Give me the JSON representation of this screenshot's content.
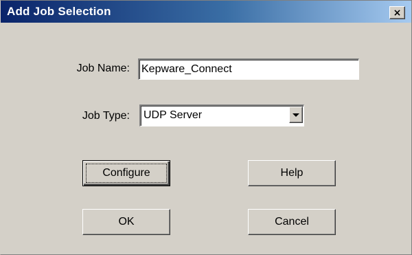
{
  "dialog": {
    "title": "Add Job Selection",
    "close_glyph": "×",
    "close_icon": "close-icon"
  },
  "form": {
    "job_name_label": "Job Name:",
    "job_name_value": "Kepware_Connect",
    "job_type_label": "Job Type:",
    "job_type_selected": "UDP Server",
    "dropdown_icon": "chevron-down-icon"
  },
  "buttons": {
    "configure": "Configure",
    "help": "Help",
    "ok": "OK",
    "cancel": "Cancel"
  },
  "colors": {
    "title_bar_start": "#0a246a",
    "title_bar_end": "#a6caf0",
    "dialog_face": "#d4d0c8"
  }
}
